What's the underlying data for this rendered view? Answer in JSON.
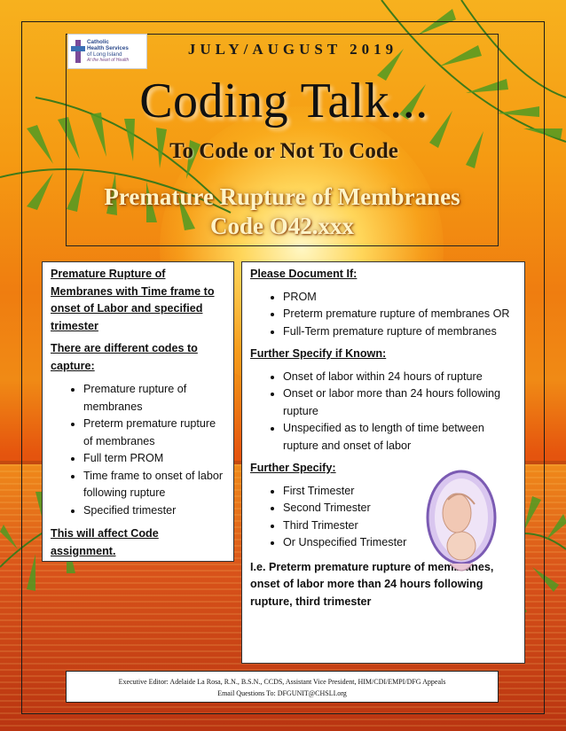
{
  "header": {
    "logo_lines": [
      "Catholic",
      "Health Services",
      "of Long Island",
      "At the heart of Health"
    ],
    "issue_date": "JULY/AUGUST 2019",
    "title": "Coding Talk...",
    "subtitle": "To Code or Not To Code",
    "topic_line1": "Premature Rupture of Membranes",
    "topic_line2": "Code O42.xxx"
  },
  "left_panel": {
    "heading_lines": [
      "Premature Rupture of",
      "Membranes with Time frame to",
      "onset of Labor and specified",
      "trimester"
    ],
    "codes_heading_lines": [
      "There are different codes to",
      "capture:"
    ],
    "items": [
      "Premature rupture of membranes",
      "Preterm premature rupture of membranes",
      "Full term PROM",
      "Time frame to onset of labor following rupture",
      "Specified trimester"
    ],
    "footer_note": "This will affect Code assignment."
  },
  "right_panel": {
    "document_heading": "Please Document If:",
    "document_items": [
      "PROM",
      "Preterm premature rupture of membranes OR",
      "Full-Term premature rupture of membranes"
    ],
    "specify_known_heading": "Further Specify if Known:",
    "specify_known_items": [
      "Onset of labor within 24 hours of rupture",
      "Onset or labor more than 24 hours following rupture",
      "Unspecified as to length of time between rupture and onset of labor"
    ],
    "specify_heading": "Further Specify:",
    "specify_items": [
      "First Trimester",
      "Second Trimester",
      "Third Trimester",
      "Or Unspecified Trimester"
    ],
    "example": "I.e. Preterm premature rupture of membranes, onset of labor more than 24 hours following rupture, third trimester"
  },
  "footer": {
    "line1": "Executive Editor: Adelaide La Rosa, R.N., B.S.N., CCDS, Assistant Vice President, HIM/CDI/EMPI/DFG Appeals",
    "line2": "Email Questions To: DFGUNIT@CHSLI.org"
  },
  "colors": {
    "title_text": "#111111",
    "topic_text": "#fff4c8",
    "sky_top": "#f7b11e",
    "sea": "#b93411"
  }
}
